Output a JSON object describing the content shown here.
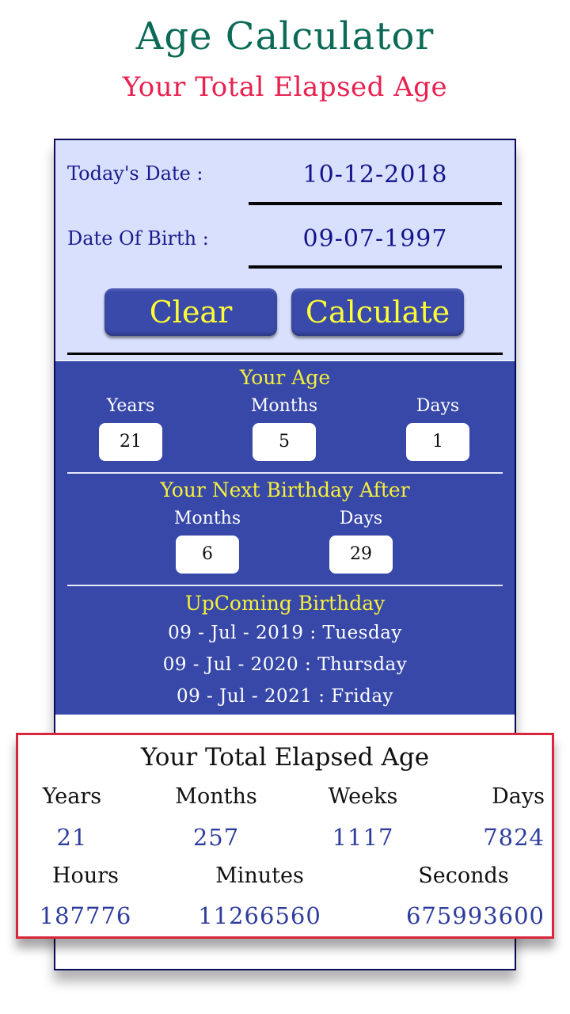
{
  "promo": {
    "title": "Age Calculator",
    "subtitle": "Your Total Elapsed Age"
  },
  "inputs": {
    "today_label": "Today's Date :",
    "today_value": "10-12-2018",
    "dob_label": "Date Of Birth :",
    "dob_value": "09-07-1997"
  },
  "buttons": {
    "clear": "Clear",
    "calculate": "Calculate"
  },
  "your_age": {
    "title": "Your Age",
    "columns": [
      {
        "label": "Years",
        "value": "21"
      },
      {
        "label": "Months",
        "value": "5"
      },
      {
        "label": "Days",
        "value": "1"
      }
    ]
  },
  "next_birthday": {
    "title": "Your Next Birthday After",
    "columns": [
      {
        "label": "Months",
        "value": "6"
      },
      {
        "label": "Days",
        "value": "29"
      }
    ]
  },
  "upcoming": {
    "title": "UpComing Birthday",
    "items": [
      "09 - Jul - 2019 : Tuesday",
      "09 - Jul - 2020 : Thursday",
      "09 - Jul - 2021 : Friday"
    ]
  },
  "total_elapsed": {
    "title": "Your Total Elapsed Age",
    "row1": [
      {
        "label": "Years",
        "value": "21"
      },
      {
        "label": "Months",
        "value": "257"
      },
      {
        "label": "Weeks",
        "value": "1117"
      },
      {
        "label": "Days",
        "value": "7824"
      }
    ],
    "row2": [
      {
        "label": "Hours",
        "value": "187776"
      },
      {
        "label": "Minutes",
        "value": "11266560"
      },
      {
        "label": "Seconds",
        "value": "675993600"
      }
    ]
  },
  "colors": {
    "title_green": "#0b6b57",
    "subtitle_red": "#e8214f",
    "panel_blue": "#3848a8",
    "input_bg": "#d9e0fd",
    "accent_yellow": "#f5f03a",
    "value_blue": "#2e3d9c",
    "card_border_red": "#d9263a"
  }
}
